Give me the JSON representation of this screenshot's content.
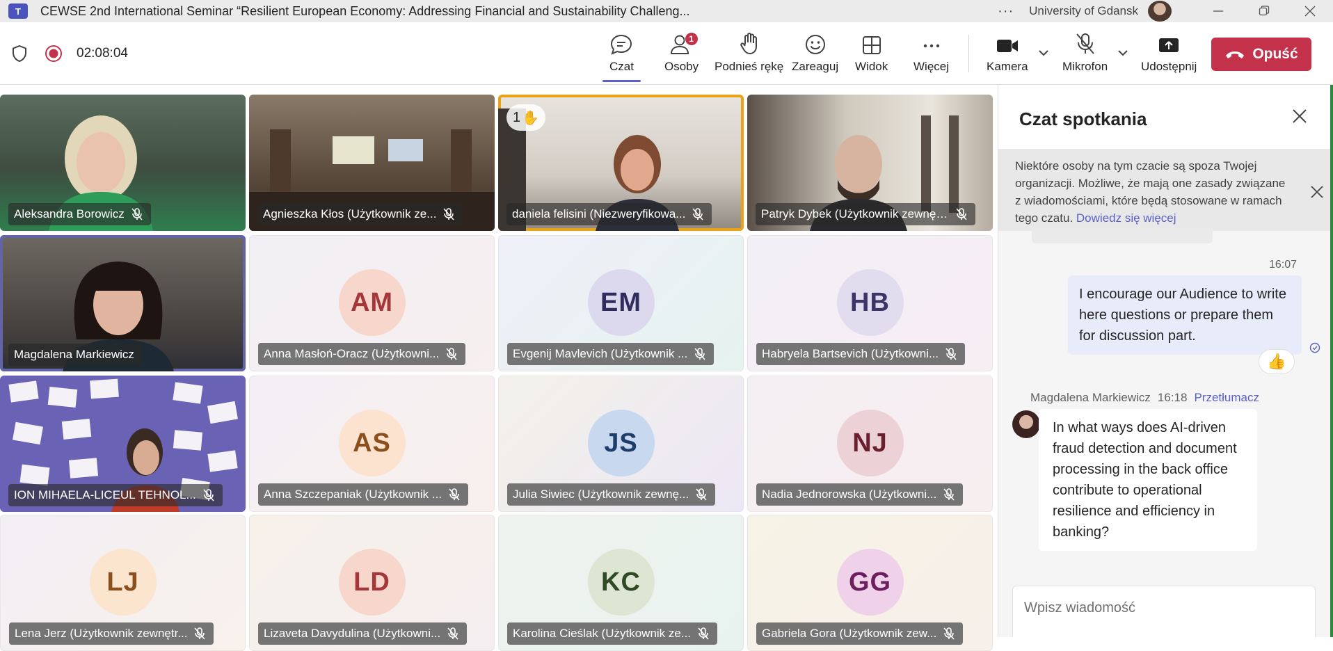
{
  "window": {
    "app_logo": "T",
    "title": "CEWSE 2nd International Seminar “Resilient European Economy: Addressing Financial and Sustainability Challeng...",
    "more": "···",
    "org": "University of Gdansk"
  },
  "toolbar": {
    "timer": "02:08:04",
    "chat_label": "Czat",
    "people_label": "Osoby",
    "people_badge": "1",
    "raise_label": "Podnieś rękę",
    "react_label": "Zareaguj",
    "view_label": "Widok",
    "more_label": "Więcej",
    "camera_label": "Kamera",
    "mic_label": "Mikrofon",
    "share_label": "Udostępnij",
    "leave_label": "Opuść"
  },
  "participants": [
    {
      "name": "Aleksandra Borowicz"
    },
    {
      "name": "Agnieszka Kłos (Użytkownik ze..."
    },
    {
      "name": "daniela felisini (Niezweryfikowa...",
      "raised_count": "1"
    },
    {
      "name": "Patryk Dybek (Użytkownik zewnętrz..."
    },
    {
      "name": "Magdalena Markiewicz"
    },
    {
      "name": "Anna Masłoń-Oracz (Użytkowni...",
      "initials": "AM"
    },
    {
      "name": "Evgenij Mavlevich (Użytkownik ...",
      "initials": "EM"
    },
    {
      "name": "Habryela Bartsevich (Użytkowni...",
      "initials": "HB"
    },
    {
      "name": "ION MIHAELA-LICEUL TEHNOL..."
    },
    {
      "name": "Anna Szczepaniak (Użytkownik ...",
      "initials": "AS"
    },
    {
      "name": "Julia Siwiec (Użytkownik zewnę...",
      "initials": "JS"
    },
    {
      "name": "Nadia Jednorowska (Użytkowni...",
      "initials": "NJ"
    },
    {
      "name": "Lena Jerz (Użytkownik zewnętr...",
      "initials": "LJ"
    },
    {
      "name": "Lizaveta Davydulina (Użytkowni...",
      "initials": "LD"
    },
    {
      "name": "Karolina Cieślak (Użytkownik ze...",
      "initials": "KC"
    },
    {
      "name": "Gabriela Gora (Użytkownik zew...",
      "initials": "GG"
    }
  ],
  "chat": {
    "title": "Czat spotkania",
    "notice": "Niektóre osoby na tym czacie są spoza Twojej organizacji. Możliwe, że mają one zasady związane z wiadomościami, które będą stosowane w ramach tego czatu.",
    "notice_link": "Dowiedz się więcej",
    "my_message_time": "16:07",
    "my_message": "I encourage our Audience to write here questions or prepare them for discussion part.",
    "reaction": "👍",
    "other_sender": "Magdalena Markiewicz",
    "other_time": "16:18",
    "translate_label": "Przetłumacz",
    "other_message": "In what ways does AI-driven fraud detection and document processing in the back office contribute to operational resilience and efficiency in banking?",
    "compose_placeholder": "Wpisz wiadomość"
  },
  "colors": {
    "accent": "#5b5fc7",
    "leave": "#c4314b",
    "badge": "#c4314b",
    "raise_highlight": "#e8a317"
  }
}
